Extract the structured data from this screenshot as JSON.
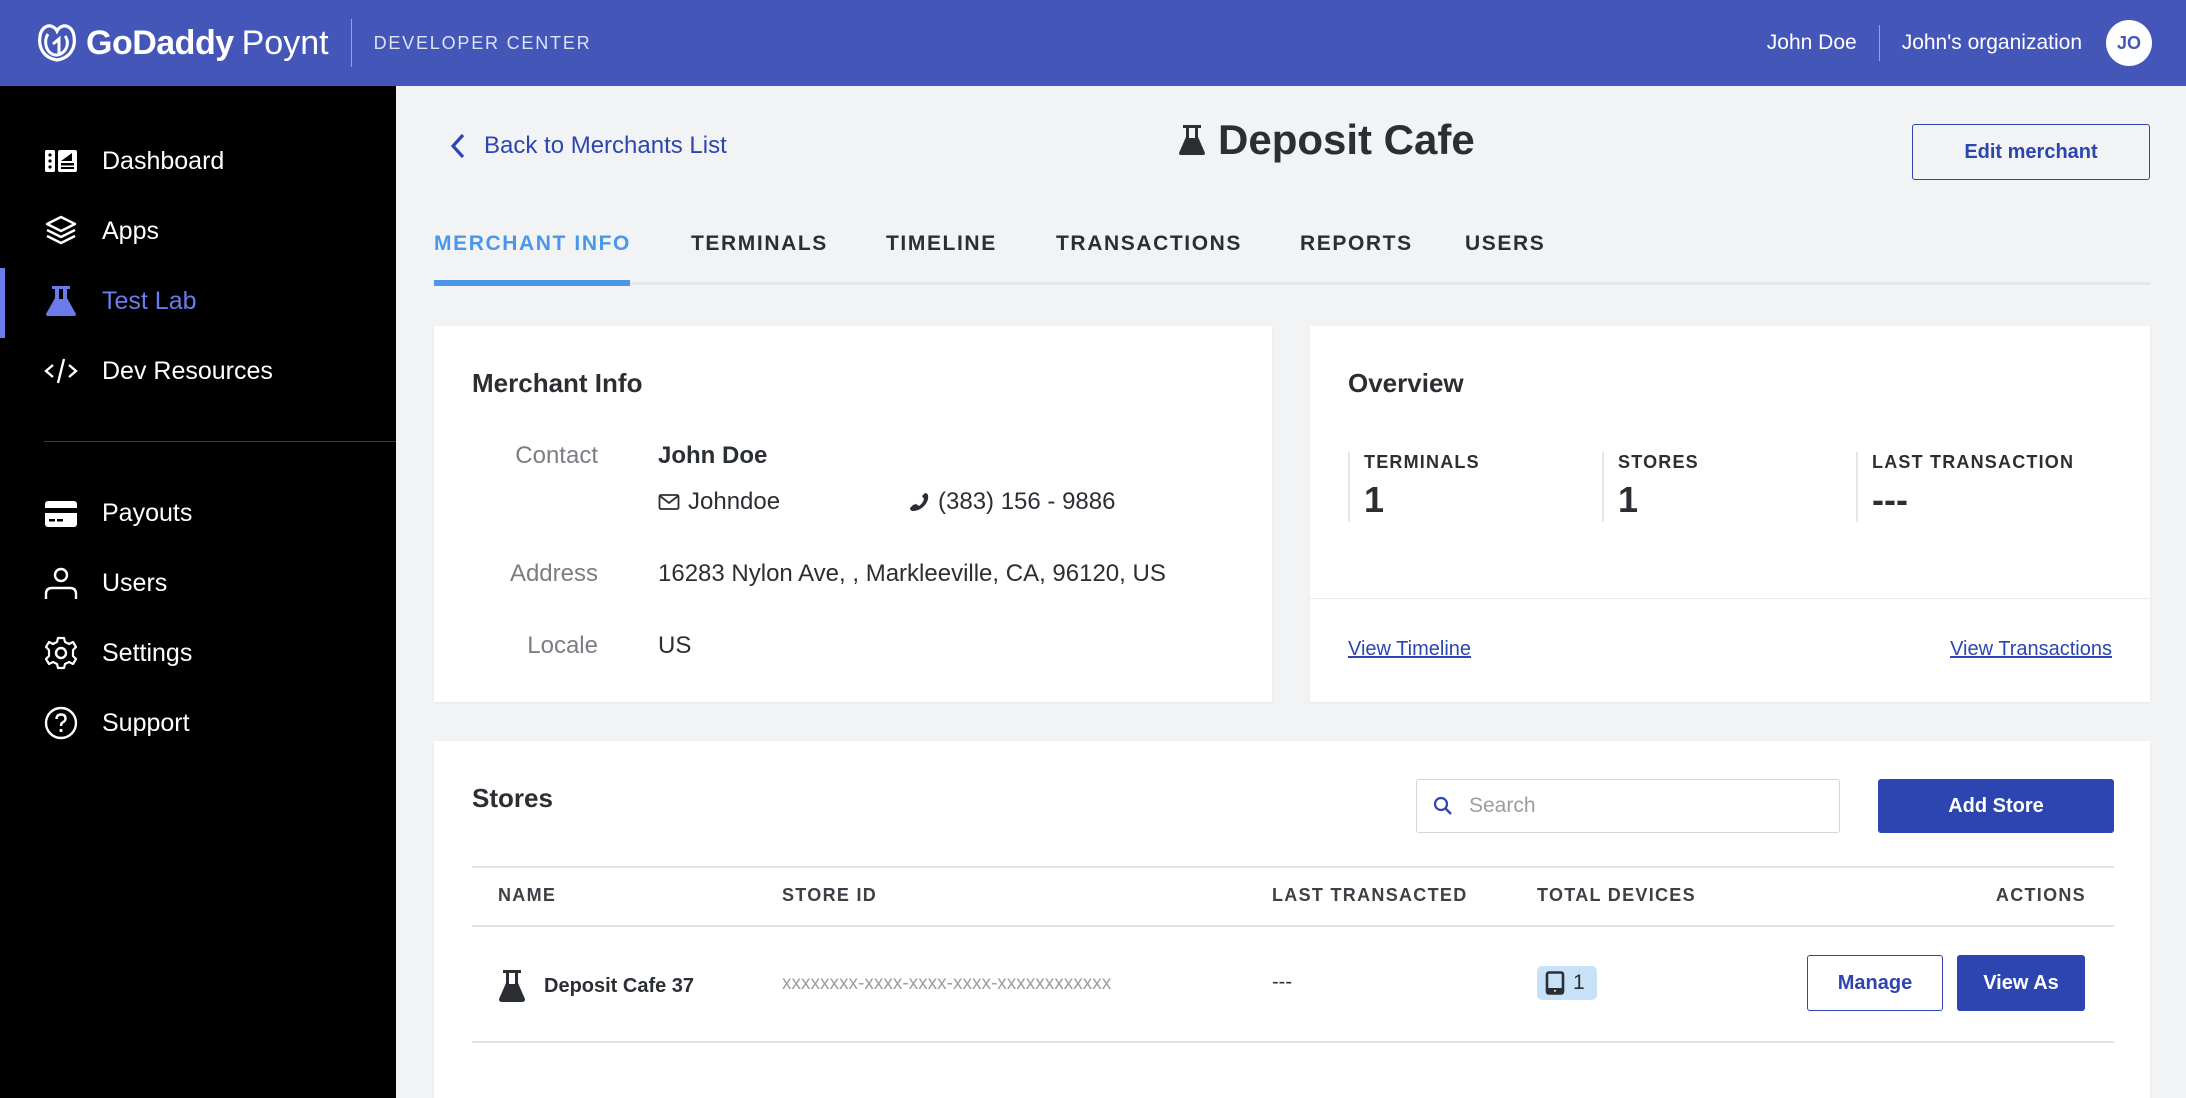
{
  "header": {
    "brand": "GoDaddy",
    "product": "Poynt",
    "section": "DEVELOPER CENTER",
    "user_name": "John Doe",
    "organization": "John's organization",
    "avatar_initials": "JO"
  },
  "sidebar": {
    "items": [
      {
        "label": "Dashboard",
        "icon": "dashboard-icon",
        "active": false
      },
      {
        "label": "Apps",
        "icon": "layers-icon",
        "active": false
      },
      {
        "label": "Test Lab",
        "icon": "flask-icon",
        "active": true
      },
      {
        "label": "Dev Resources",
        "icon": "code-icon",
        "active": false
      },
      {
        "label": "Payouts",
        "icon": "credit-card-icon",
        "active": false
      },
      {
        "label": "Users",
        "icon": "user-icon",
        "active": false
      },
      {
        "label": "Settings",
        "icon": "gear-icon",
        "active": false
      },
      {
        "label": "Support",
        "icon": "help-circle-icon",
        "active": false
      }
    ]
  },
  "page": {
    "back_label": "Back to Merchants List",
    "title": "Deposit Cafe",
    "edit_button": "Edit merchant",
    "tabs": [
      {
        "label": "MERCHANT INFO",
        "active": true
      },
      {
        "label": "TERMINALS",
        "active": false
      },
      {
        "label": "TIMELINE",
        "active": false
      },
      {
        "label": "TRANSACTIONS",
        "active": false
      },
      {
        "label": "REPORTS",
        "active": false
      },
      {
        "label": "USERS",
        "active": false
      }
    ]
  },
  "merchant_info": {
    "title": "Merchant Info",
    "contact_label": "Contact",
    "contact_name": "John Doe",
    "email": "Johndoe",
    "phone": "(383) 156 - 9886",
    "address_label": "Address",
    "address": "16283 Nylon Ave, , Markleeville, CA, 96120, US",
    "locale_label": "Locale",
    "locale": "US"
  },
  "overview": {
    "title": "Overview",
    "stats": [
      {
        "label": "TERMINALS",
        "value": "1"
      },
      {
        "label": "STORES",
        "value": "1"
      },
      {
        "label": "LAST TRANSACTION",
        "value": "---"
      }
    ],
    "view_timeline": "View Timeline",
    "view_transactions": "View Transactions"
  },
  "stores": {
    "title": "Stores",
    "search_placeholder": "Search",
    "search_value": "",
    "add_button": "Add Store",
    "columns": [
      "NAME",
      "STORE ID",
      "LAST TRANSACTED",
      "TOTAL DEVICES",
      "ACTIONS"
    ],
    "rows": [
      {
        "name": "Deposit Cafe 37",
        "store_id": "xxxxxxxx-xxxx-xxxx-xxxx-xxxxxxxxxxxx",
        "last_transacted": "---",
        "total_devices": "1",
        "manage_label": "Manage",
        "view_as_label": "View As"
      }
    ]
  },
  "colors": {
    "header_bg": "#4456b8",
    "sidebar_bg": "#000000",
    "accent_active": "#6b7bea",
    "tab_active": "#4a97ea",
    "primary_button": "#2d45b0",
    "device_badge_bg": "#c7e2f8"
  }
}
